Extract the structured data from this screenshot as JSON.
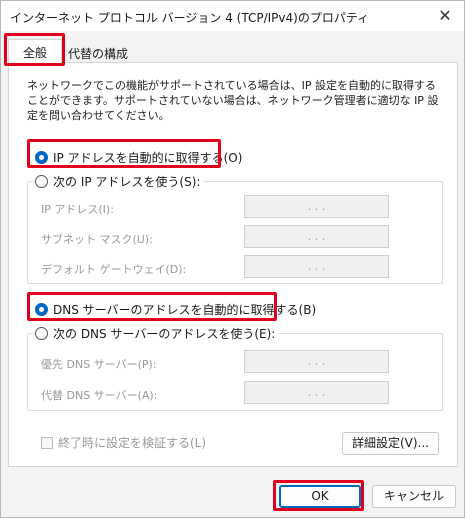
{
  "window": {
    "title": "インターネット プロトコル バージョン 4 (TCP/IPv4)のプロパティ",
    "close_glyph": "✕"
  },
  "tabs": [
    {
      "label": "全般"
    },
    {
      "label": "代替の構成"
    }
  ],
  "description": "ネットワークでこの機能がサポートされている場合は、IP 設定を自動的に取得することができます。サポートされていない場合は、ネットワーク管理者に適切な IP 設定を問い合わせてください。",
  "ip": {
    "auto_label": "IP アドレスを自動的に取得する(O)",
    "auto_selected": true,
    "manual_label": "次の IP アドレスを使う(S):",
    "fields": [
      {
        "label": "IP アドレス(I):",
        "value": ". . ."
      },
      {
        "label": "サブネット マスク(U):",
        "value": ". . ."
      },
      {
        "label": "デフォルト ゲートウェイ(D):",
        "value": ". . ."
      }
    ]
  },
  "dns": {
    "auto_label": "DNS サーバーのアドレスを自動的に取得する(B)",
    "auto_selected": true,
    "manual_label": "次の DNS サーバーのアドレスを使う(E):",
    "fields": [
      {
        "label": "優先 DNS サーバー(P):",
        "value": ". . ."
      },
      {
        "label": "代替 DNS サーバー(A):",
        "value": ". . ."
      }
    ]
  },
  "validate_label": "終了時に設定を検証する(L)",
  "advanced_label": "詳細設定(V)...",
  "ok_label": "OK",
  "cancel_label": "キャンセル",
  "colors": {
    "highlight": "#e0001b",
    "accent": "#0067c0"
  }
}
